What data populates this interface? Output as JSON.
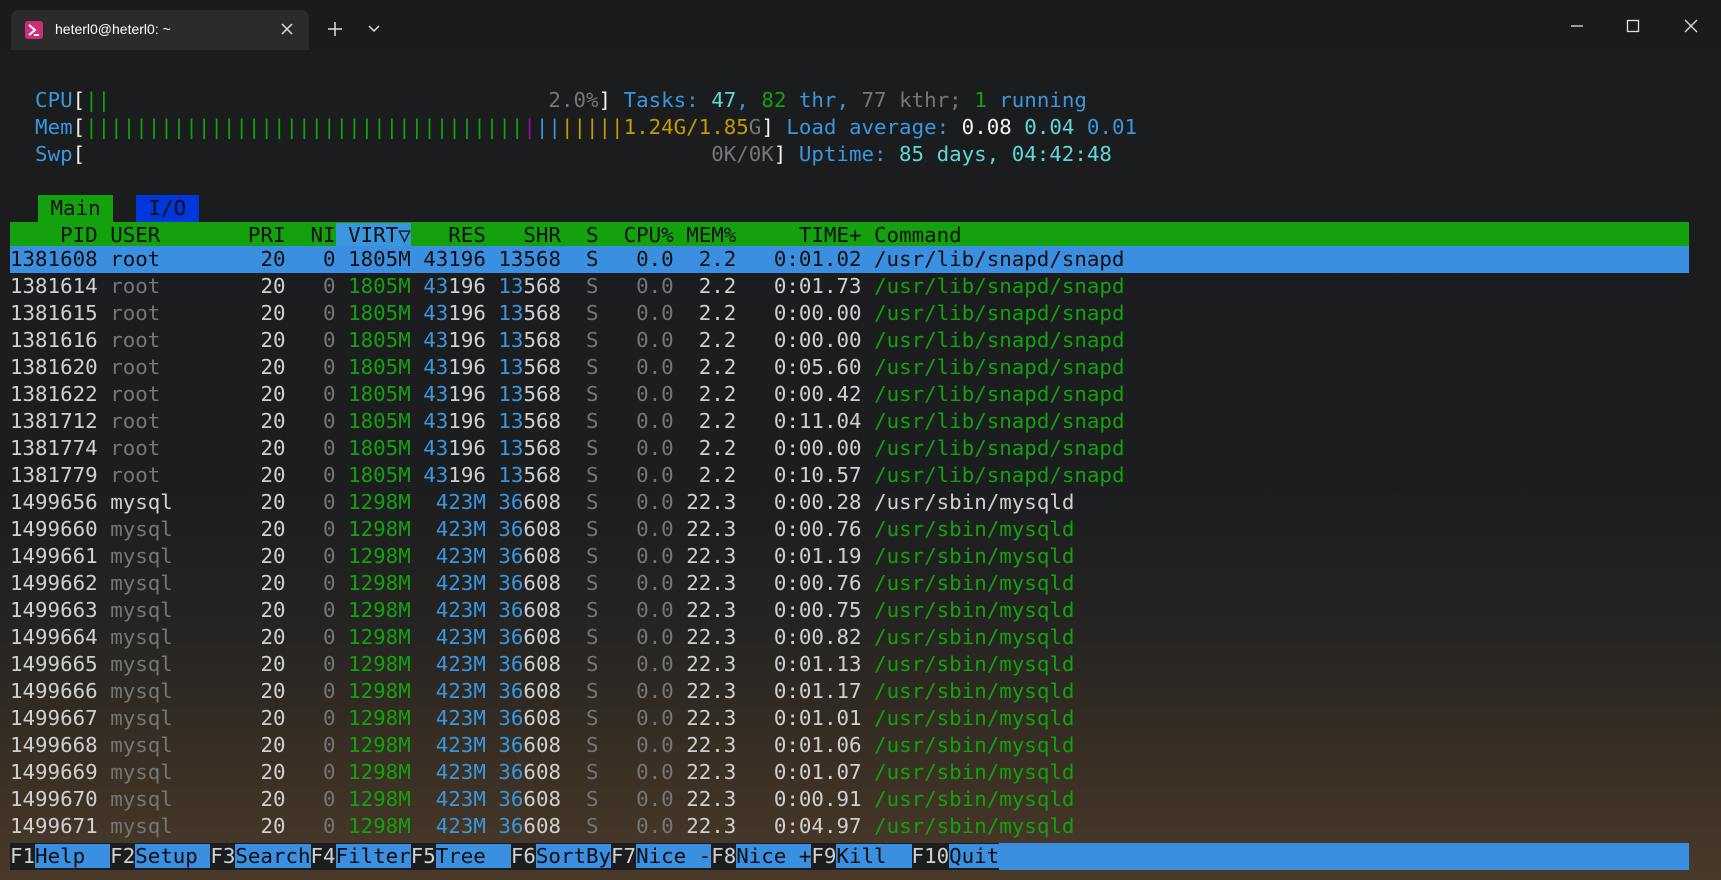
{
  "window": {
    "tab_title": "heterl0@heterl0: ~"
  },
  "meters": {
    "cpu_label": "CPU",
    "cpu_bars": "||",
    "cpu_value": "2.0%",
    "mem_label": "Mem",
    "mem_bars_green": "|||||||||||||||||||||||||||||||||||||||||||||||||||||||||||||||||||||||||||",
    "mem_bars_magenta": "|",
    "mem_bars_blue": "||",
    "mem_bars_yellow": "|||||",
    "mem_value_a": "1.24G/1.85",
    "mem_value_b": "G",
    "swp_label": "Swp",
    "swp_value": "0K/0K"
  },
  "summary": {
    "tasks_label": "Tasks: ",
    "tasks_count": "47",
    "thr_count": "82",
    "thr_label": " thr",
    "kthr_count": "77",
    "kthr_label": " kthr",
    "running_count": "1",
    "running_label": " running",
    "load_label": "Load average: ",
    "load_1": "0.08",
    "load_5": "0.04",
    "load_15": "0.01",
    "uptime_label": "Uptime: ",
    "uptime_value": "85 days, 04:42:48"
  },
  "screen_tabs": [
    {
      "label": "Main"
    },
    {
      "label": "I/O"
    }
  ],
  "columns": [
    "PID",
    "USER",
    "PRI",
    "NI",
    "VIRT",
    "RES",
    "SHR",
    "S",
    "CPU%",
    "MEM%",
    "TIME+",
    "Command"
  ],
  "sort_indicator": "▽",
  "processes": [
    {
      "pid": "1381608",
      "user": "root",
      "pri": "20",
      "ni": "0",
      "virt": "1805M",
      "res": "43196",
      "shr": "13568",
      "s": "S",
      "cpu": "0.0",
      "mem": "2.2",
      "time": "0:01.02",
      "cmd": "/usr/lib/snapd/snapd"
    },
    {
      "pid": "1381614",
      "user": "root",
      "pri": "20",
      "ni": "0",
      "virt": "1805M",
      "res": "43196",
      "shr": "13568",
      "s": "S",
      "cpu": "0.0",
      "mem": "2.2",
      "time": "0:01.73",
      "cmd": "/usr/lib/snapd/snapd"
    },
    {
      "pid": "1381615",
      "user": "root",
      "pri": "20",
      "ni": "0",
      "virt": "1805M",
      "res": "43196",
      "shr": "13568",
      "s": "S",
      "cpu": "0.0",
      "mem": "2.2",
      "time": "0:00.00",
      "cmd": "/usr/lib/snapd/snapd"
    },
    {
      "pid": "1381616",
      "user": "root",
      "pri": "20",
      "ni": "0",
      "virt": "1805M",
      "res": "43196",
      "shr": "13568",
      "s": "S",
      "cpu": "0.0",
      "mem": "2.2",
      "time": "0:00.00",
      "cmd": "/usr/lib/snapd/snapd"
    },
    {
      "pid": "1381620",
      "user": "root",
      "pri": "20",
      "ni": "0",
      "virt": "1805M",
      "res": "43196",
      "shr": "13568",
      "s": "S",
      "cpu": "0.0",
      "mem": "2.2",
      "time": "0:05.60",
      "cmd": "/usr/lib/snapd/snapd"
    },
    {
      "pid": "1381622",
      "user": "root",
      "pri": "20",
      "ni": "0",
      "virt": "1805M",
      "res": "43196",
      "shr": "13568",
      "s": "S",
      "cpu": "0.0",
      "mem": "2.2",
      "time": "0:00.42",
      "cmd": "/usr/lib/snapd/snapd"
    },
    {
      "pid": "1381712",
      "user": "root",
      "pri": "20",
      "ni": "0",
      "virt": "1805M",
      "res": "43196",
      "shr": "13568",
      "s": "S",
      "cpu": "0.0",
      "mem": "2.2",
      "time": "0:11.04",
      "cmd": "/usr/lib/snapd/snapd"
    },
    {
      "pid": "1381774",
      "user": "root",
      "pri": "20",
      "ni": "0",
      "virt": "1805M",
      "res": "43196",
      "shr": "13568",
      "s": "S",
      "cpu": "0.0",
      "mem": "2.2",
      "time": "0:00.00",
      "cmd": "/usr/lib/snapd/snapd"
    },
    {
      "pid": "1381779",
      "user": "root",
      "pri": "20",
      "ni": "0",
      "virt": "1805M",
      "res": "43196",
      "shr": "13568",
      "s": "S",
      "cpu": "0.0",
      "mem": "2.2",
      "time": "0:10.57",
      "cmd": "/usr/lib/snapd/snapd"
    },
    {
      "pid": "1499656",
      "user": "mysql",
      "pri": "20",
      "ni": "0",
      "virt": "1298M",
      "res": "423M",
      "shr": "36608",
      "s": "S",
      "cpu": "0.0",
      "mem": "22.3",
      "time": "0:00.28",
      "cmd": "/usr/sbin/mysqld"
    },
    {
      "pid": "1499660",
      "user": "mysql",
      "pri": "20",
      "ni": "0",
      "virt": "1298M",
      "res": "423M",
      "shr": "36608",
      "s": "S",
      "cpu": "0.0",
      "mem": "22.3",
      "time": "0:00.76",
      "cmd": "/usr/sbin/mysqld"
    },
    {
      "pid": "1499661",
      "user": "mysql",
      "pri": "20",
      "ni": "0",
      "virt": "1298M",
      "res": "423M",
      "shr": "36608",
      "s": "S",
      "cpu": "0.0",
      "mem": "22.3",
      "time": "0:01.19",
      "cmd": "/usr/sbin/mysqld"
    },
    {
      "pid": "1499662",
      "user": "mysql",
      "pri": "20",
      "ni": "0",
      "virt": "1298M",
      "res": "423M",
      "shr": "36608",
      "s": "S",
      "cpu": "0.0",
      "mem": "22.3",
      "time": "0:00.76",
      "cmd": "/usr/sbin/mysqld"
    },
    {
      "pid": "1499663",
      "user": "mysql",
      "pri": "20",
      "ni": "0",
      "virt": "1298M",
      "res": "423M",
      "shr": "36608",
      "s": "S",
      "cpu": "0.0",
      "mem": "22.3",
      "time": "0:00.75",
      "cmd": "/usr/sbin/mysqld"
    },
    {
      "pid": "1499664",
      "user": "mysql",
      "pri": "20",
      "ni": "0",
      "virt": "1298M",
      "res": "423M",
      "shr": "36608",
      "s": "S",
      "cpu": "0.0",
      "mem": "22.3",
      "time": "0:00.82",
      "cmd": "/usr/sbin/mysqld"
    },
    {
      "pid": "1499665",
      "user": "mysql",
      "pri": "20",
      "ni": "0",
      "virt": "1298M",
      "res": "423M",
      "shr": "36608",
      "s": "S",
      "cpu": "0.0",
      "mem": "22.3",
      "time": "0:01.13",
      "cmd": "/usr/sbin/mysqld"
    },
    {
      "pid": "1499666",
      "user": "mysql",
      "pri": "20",
      "ni": "0",
      "virt": "1298M",
      "res": "423M",
      "shr": "36608",
      "s": "S",
      "cpu": "0.0",
      "mem": "22.3",
      "time": "0:01.17",
      "cmd": "/usr/sbin/mysqld"
    },
    {
      "pid": "1499667",
      "user": "mysql",
      "pri": "20",
      "ni": "0",
      "virt": "1298M",
      "res": "423M",
      "shr": "36608",
      "s": "S",
      "cpu": "0.0",
      "mem": "22.3",
      "time": "0:01.01",
      "cmd": "/usr/sbin/mysqld"
    },
    {
      "pid": "1499668",
      "user": "mysql",
      "pri": "20",
      "ni": "0",
      "virt": "1298M",
      "res": "423M",
      "shr": "36608",
      "s": "S",
      "cpu": "0.0",
      "mem": "22.3",
      "time": "0:01.06",
      "cmd": "/usr/sbin/mysqld"
    },
    {
      "pid": "1499669",
      "user": "mysql",
      "pri": "20",
      "ni": "0",
      "virt": "1298M",
      "res": "423M",
      "shr": "36608",
      "s": "S",
      "cpu": "0.0",
      "mem": "22.3",
      "time": "0:01.07",
      "cmd": "/usr/sbin/mysqld"
    },
    {
      "pid": "1499670",
      "user": "mysql",
      "pri": "20",
      "ni": "0",
      "virt": "1298M",
      "res": "423M",
      "shr": "36608",
      "s": "S",
      "cpu": "0.0",
      "mem": "22.3",
      "time": "0:00.91",
      "cmd": "/usr/sbin/mysqld"
    },
    {
      "pid": "1499671",
      "user": "mysql",
      "pri": "20",
      "ni": "0",
      "virt": "1298M",
      "res": "423M",
      "shr": "36608",
      "s": "S",
      "cpu": "0.0",
      "mem": "22.3",
      "time": "0:04.97",
      "cmd": "/usr/sbin/mysqld"
    }
  ],
  "function_keys": [
    {
      "key": "F1",
      "label": "Help  "
    },
    {
      "key": "F2",
      "label": "Setup "
    },
    {
      "key": "F3",
      "label": "Search"
    },
    {
      "key": "F4",
      "label": "Filter"
    },
    {
      "key": "F5",
      "label": "Tree  "
    },
    {
      "key": "F6",
      "label": "SortBy"
    },
    {
      "key": "F7",
      "label": "Nice -"
    },
    {
      "key": "F8",
      "label": "Nice +"
    },
    {
      "key": "F9",
      "label": "Kill  "
    },
    {
      "key": "F10",
      "label": "Quit"
    }
  ],
  "colors": {
    "cyan": "#3a96dd",
    "green": "#13a10e",
    "gray": "#767676",
    "white": "#d0d0d0",
    "bright_white": "#f2f2f2",
    "yellow": "#c19c00",
    "magenta": "#881798",
    "blue_tab": "#0037da",
    "teal": "#61d6d6",
    "selection": "#3b8fe0"
  }
}
